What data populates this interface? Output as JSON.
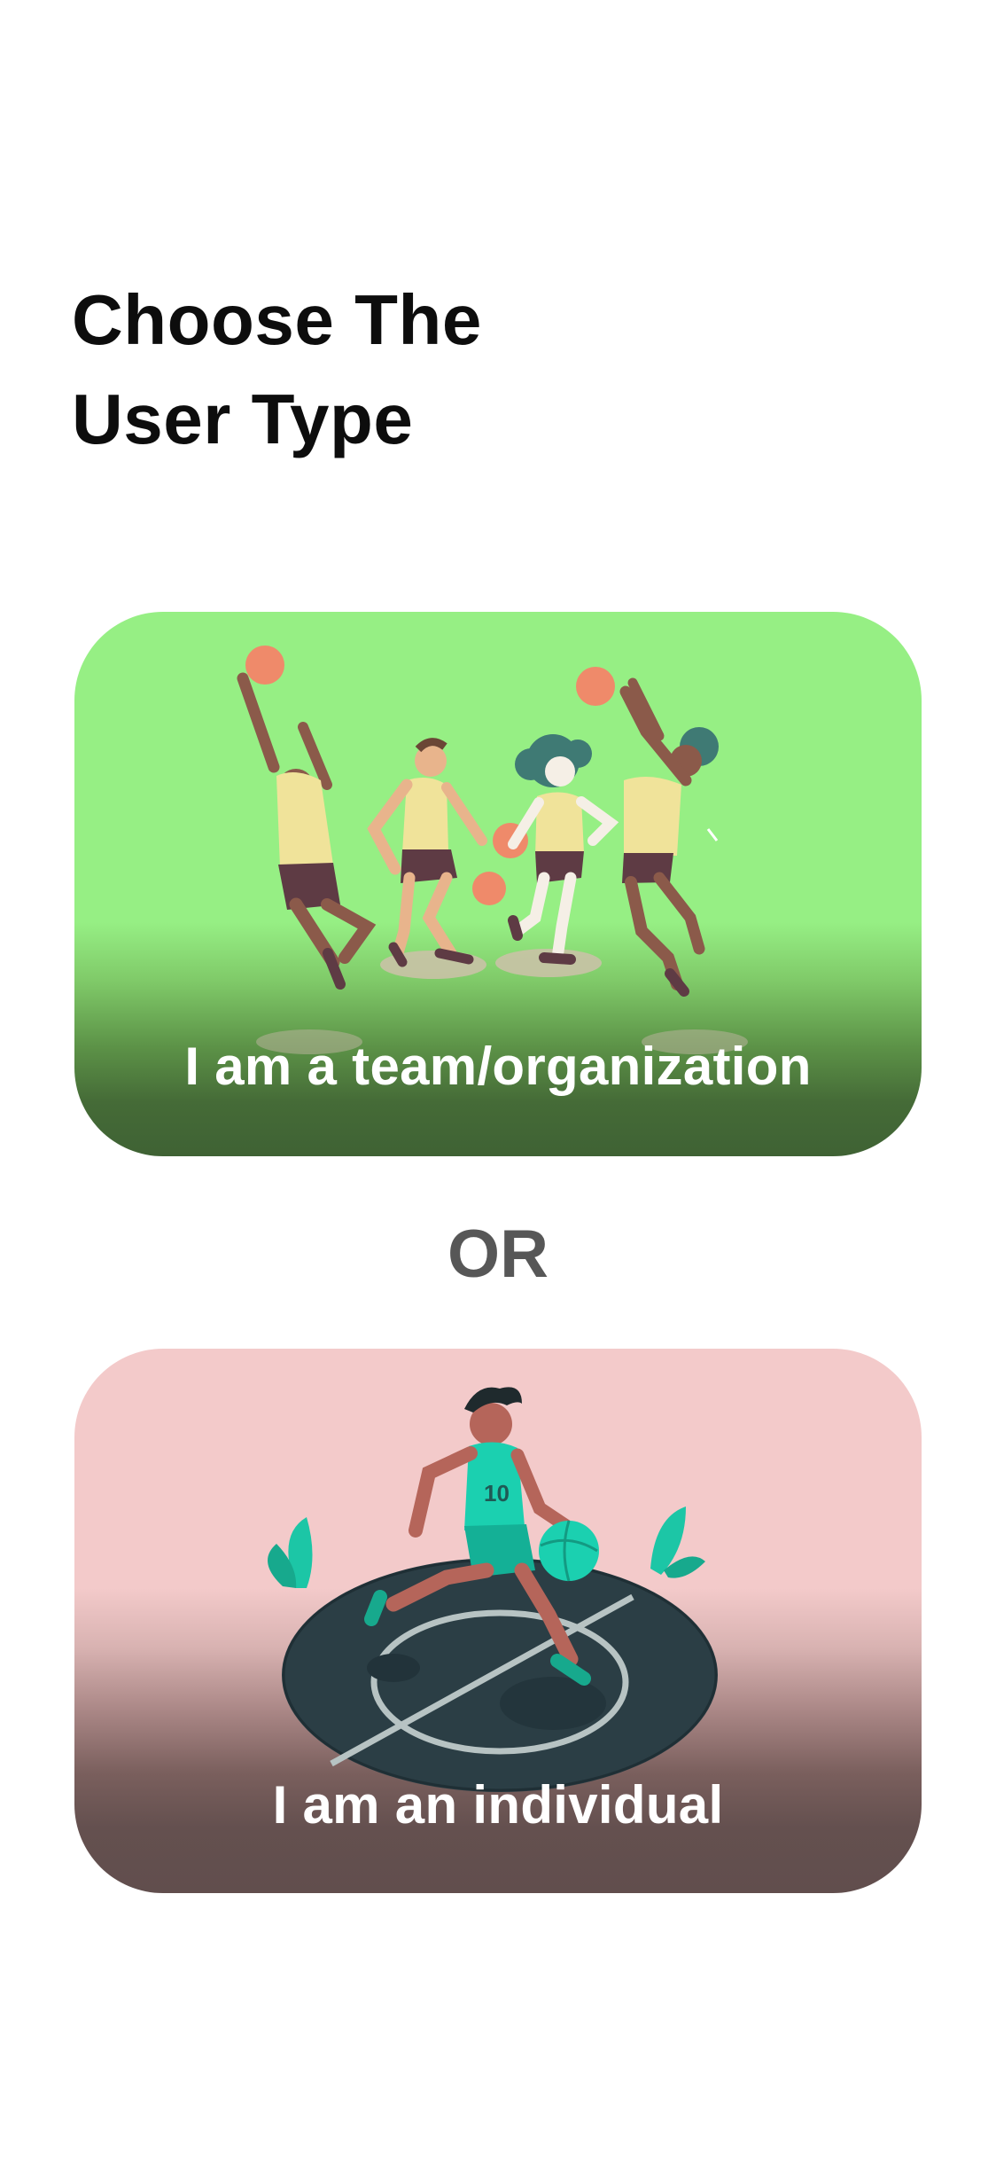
{
  "header": {
    "title_line_1": "Choose The",
    "title_line_2": "User Type"
  },
  "options": {
    "team": {
      "label": "I am a team/organization",
      "background": "#96ef84"
    },
    "divider": "OR",
    "individual": {
      "label": "I am an individual",
      "background": "#f3caca",
      "jersey_number": "10"
    }
  },
  "icons": {
    "team_illustration": "basketball-team-icon",
    "individual_illustration": "basketball-player-icon"
  }
}
